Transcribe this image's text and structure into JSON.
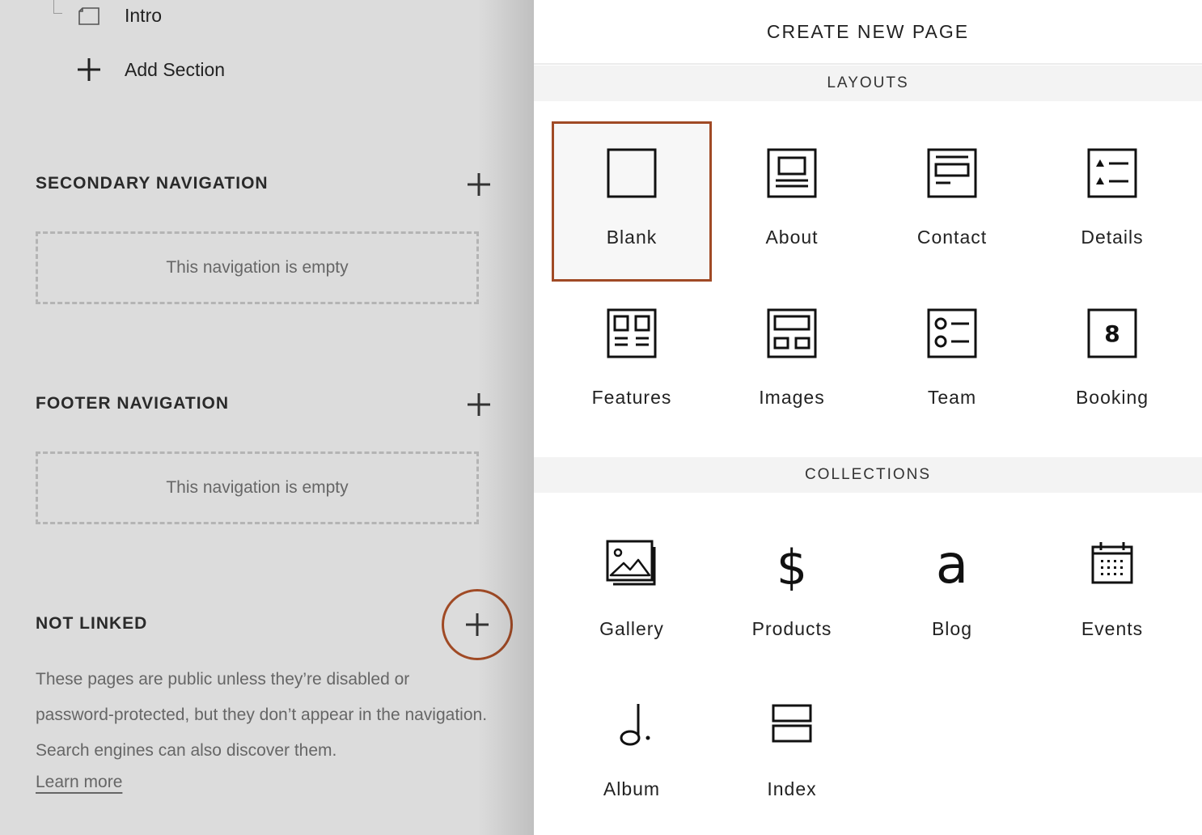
{
  "left": {
    "intro": "Intro",
    "add_section": "Add Section",
    "secondary": {
      "title": "SECONDARY NAVIGATION",
      "empty": "This navigation is empty"
    },
    "footer": {
      "title": "FOOTER NAVIGATION",
      "empty": "This navigation is empty"
    },
    "not_linked": {
      "title": "NOT LINKED",
      "description": "These pages are public unless they’re disabled or password-protected, but they don’t appear in the navigation. Search engines can also discover them.",
      "learn_more": "Learn more"
    }
  },
  "right": {
    "title": "CREATE NEW PAGE",
    "layouts": {
      "title": "LAYOUTS",
      "items": [
        {
          "label": "Blank",
          "icon": "blank-page-icon",
          "selected": true
        },
        {
          "label": "About",
          "icon": "about-layout-icon"
        },
        {
          "label": "Contact",
          "icon": "contact-layout-icon"
        },
        {
          "label": "Details",
          "icon": "details-layout-icon"
        },
        {
          "label": "Features",
          "icon": "features-layout-icon"
        },
        {
          "label": "Images",
          "icon": "images-layout-icon"
        },
        {
          "label": "Team",
          "icon": "team-layout-icon"
        },
        {
          "label": "Booking",
          "icon": "booking-calendar-icon",
          "icon_text": "8"
        }
      ]
    },
    "collections": {
      "title": "COLLECTIONS",
      "items": [
        {
          "label": "Gallery",
          "icon": "gallery-icon"
        },
        {
          "label": "Products",
          "icon": "dollar-icon",
          "icon_text": "$"
        },
        {
          "label": "Blog",
          "icon": "blog-letter-icon",
          "icon_text": "a"
        },
        {
          "label": "Events",
          "icon": "calendar-icon"
        },
        {
          "label": "Album",
          "icon": "music-note-icon"
        },
        {
          "label": "Index",
          "icon": "index-stack-icon"
        }
      ]
    }
  },
  "colors": {
    "accent": "#a04a25",
    "left_bg": "#dcdcdc",
    "section_bar": "#f3f3f3"
  }
}
